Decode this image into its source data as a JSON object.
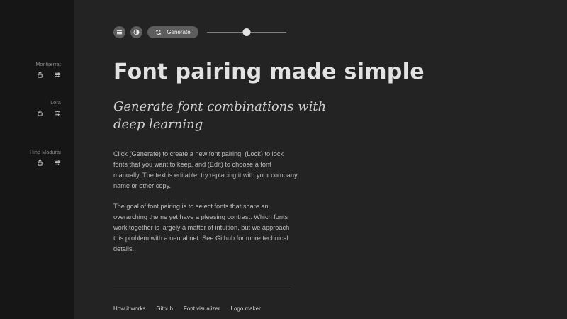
{
  "sidebar": {
    "fonts": [
      {
        "name": "Montserrat",
        "lock_icon": "lock-icon",
        "edit_icon": "sliders-icon"
      },
      {
        "name": "Lora",
        "lock_icon": "lock-icon",
        "edit_icon": "sliders-icon"
      },
      {
        "name": "Hind Madurai",
        "lock_icon": "lock-icon",
        "edit_icon": "sliders-icon"
      }
    ]
  },
  "toolbar": {
    "list_icon": "list-icon",
    "contrast_icon": "contrast-icon",
    "generate_icon": "refresh-icon",
    "generate_label": "Generate",
    "slider_value": 0.5
  },
  "content": {
    "headline": "Font pairing made simple",
    "subheadline": "Generate font combinations with deep learning",
    "paragraphs": [
      "Click (Generate) to create a new font pairing, (Lock) to lock fonts that you want to keep, and (Edit) to choose a font manually. The text is editable, try replacing it with your company name or other copy.",
      "The goal of font pairing is to select fonts that share an overarching theme yet have a pleasing contrast. Which fonts work together is largely a matter of intuition, but we approach this problem with a neural net. See Github for more technical details."
    ]
  },
  "footer": {
    "links": [
      "How it works",
      "Github",
      "Font visualizer",
      "Logo maker"
    ]
  },
  "colors": {
    "background": "#232323",
    "sidebar": "#161616",
    "button": "#5d5d5d",
    "text": "#e2e2e2"
  }
}
